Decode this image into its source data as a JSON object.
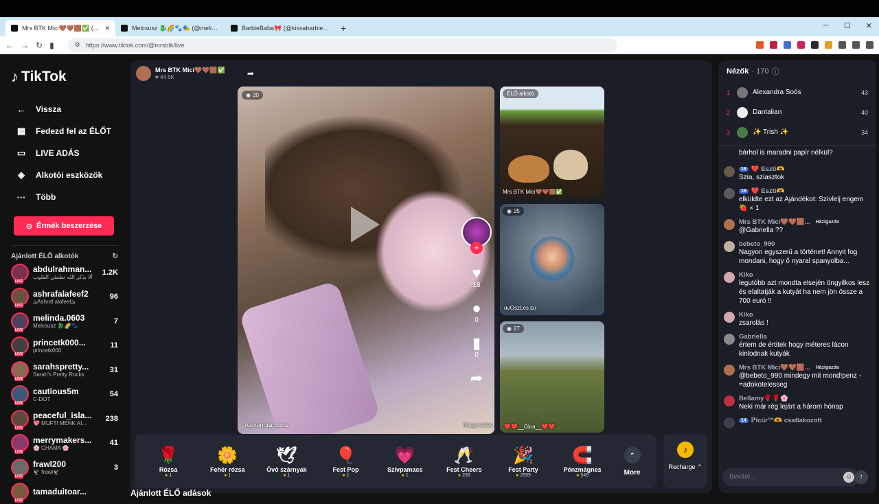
{
  "browser": {
    "tabs": [
      {
        "title": "Mrs BTK Mici🤎🤎🟫✅ (@m"
      },
      {
        "title": "Melcsusz 🐉🌈🐾🎭 (@melinda"
      },
      {
        "title": "BarbieBaba🎀 (@kissabarbie) ÉLŐ ad"
      }
    ],
    "new_tab": "+",
    "url": "https://www.tiktok.com/@mrsbtk/live"
  },
  "sidebar": {
    "logo": "TikTok",
    "nav": [
      {
        "label": "Vissza",
        "icon": "←"
      },
      {
        "label": "Fedezd fel az ÉLŐT",
        "icon": "▦"
      },
      {
        "label": "LIVE ADÁS",
        "icon": "▭"
      },
      {
        "label": "Alkotói eszközök",
        "icon": "◈"
      },
      {
        "label": "Több",
        "icon": "···"
      }
    ],
    "coins_button": "Érmék beszerzése",
    "recommended_title": "Ajánlott ÉLŐ alkotók",
    "creators": [
      {
        "name": "abdulrahman...",
        "sub": "ألا بذكر الله تطمئن القلوب",
        "count": "1.2K",
        "color": "#7a3050"
      },
      {
        "name": "ashrafalafeef2",
        "sub": "ئAshraf alafeefئ",
        "count": "96",
        "color": "#6a5040"
      },
      {
        "name": "melinda.0603",
        "sub": "Melcsusz 🐉🌈🐾",
        "count": "7",
        "color": "#504060"
      },
      {
        "name": "princetk000...",
        "sub": "princetk000",
        "count": "11",
        "color": "#404040"
      },
      {
        "name": "sarahspretty...",
        "sub": "Sarah's Pretty Rocks",
        "count": "31",
        "color": "#8a6a50"
      },
      {
        "name": "cautious5m",
        "sub": "C-DOT",
        "count": "54",
        "color": "#3a5a7a"
      },
      {
        "name": "peaceful_isla...",
        "sub": "💖 MUFTI MENK AI...",
        "count": "238",
        "color": "#5a4a3a"
      },
      {
        "name": "merrymakers...",
        "sub": "🌸 CHAMA 🌸",
        "count": "41",
        "color": "#8a3a6a"
      },
      {
        "name": "frawl200",
        "sub": "🦅 frawl🦅",
        "count": "3",
        "color": "#6a6a6a"
      },
      {
        "name": "tamaduitoar...",
        "sub": "",
        "count": "",
        "color": "#7a5a3a"
      }
    ]
  },
  "live": {
    "host_name": "Mrs BTK Mici🤎🤎🟫✅",
    "host_likes": "♥ 44.5K",
    "viewer_badge": "20",
    "video_user": "Alexandra Soós",
    "likes": "18",
    "comments": "0",
    "saves": "0",
    "share_label": "Megosztás",
    "side_streams": [
      {
        "badge": "ÉLŐ alkotó",
        "label": "Mrs BTK Mici🤎🤎🟫✅"
      },
      {
        "badge": "25",
        "label": "ʜᴜOszĿes ᴇᴜ"
      },
      {
        "badge": "27",
        "label": "❤️❤️__Gina__❤️❤️..."
      }
    ]
  },
  "gifts": [
    {
      "name": "Rózsa",
      "price": "1",
      "icon": "🌹"
    },
    {
      "name": "Fehér rózsa",
      "price": "1",
      "icon": "🌼"
    },
    {
      "name": "Óvó szárnyak",
      "price": "1",
      "icon": "🕊"
    },
    {
      "name": "Fest Pop",
      "price": "1",
      "icon": "🎈"
    },
    {
      "name": "Szívpamacs",
      "price": "1",
      "icon": "💗"
    },
    {
      "name": "Fest Cheers",
      "price": "299",
      "icon": "🥂"
    },
    {
      "name": "Fest Party",
      "price": "2999",
      "icon": "🎉"
    },
    {
      "name": "Pénzmágnes",
      "price": "549",
      "icon": "🧲"
    }
  ],
  "more_label": "More",
  "recharge_label": "Recharge ⌃",
  "bottom_title": "Ajánlott ÉLŐ adások",
  "chat": {
    "viewers_title": "Nézők",
    "viewers_count": "· 170",
    "top_viewers": [
      {
        "rank": "1",
        "name": "Alexandra Soós",
        "score": "43"
      },
      {
        "rank": "2",
        "name": "Dantalian",
        "score": "40"
      },
      {
        "rank": "3",
        "name": "✨ Trish ✨",
        "score": "34"
      }
    ],
    "messages": [
      {
        "user": "",
        "level": "",
        "host": "",
        "text": "bárhol is maradni papír nélkül?",
        "color": "transparent"
      },
      {
        "user": "❤️ Eszti🫶",
        "level": "16",
        "host": "",
        "text": "Szia, sziasztok",
        "color": "#6a5a4a"
      },
      {
        "user": "❤️ Eszti🫶",
        "level": "16",
        "host": "",
        "text": "elküldte ezt az Ajándékot: Szívlelj engem 🍓 × 1",
        "color": "#5a5a5a"
      },
      {
        "user": "Mrs BTK Mici🤎🤎🟫...",
        "level": "",
        "host": "Házigazda",
        "text": "@Gabriella ??",
        "color": "#b07050"
      },
      {
        "user": "bebeto_990",
        "level": "",
        "host": "",
        "text": "Nagyon egyszerű a történet! Annyit fog mondani, hogy ő nyaral spanyolba...",
        "color": "#c0b0a0"
      },
      {
        "user": "Kiko",
        "level": "",
        "host": "",
        "text": "legutóbb azt mondta elsején öngyilkos lesz és elaltatják a kutyát ha nem jön össze a 700 euró !!",
        "color": "#d0a8b0"
      },
      {
        "user": "Kiko",
        "level": "",
        "host": "",
        "text": "zsarolás !",
        "color": "#d0a8b0"
      },
      {
        "user": "Gabriella",
        "level": "",
        "host": "",
        "text": "értem de értitek hogy méteres lácon kinlodnak kutyák",
        "color": "#8a8a8a"
      },
      {
        "user": "Mrs BTK Mici🤎🤎🟫...",
        "level": "",
        "host": "Házigazda",
        "text": "@bebeto_990 mindegy mit mond!penz -=adokotelesseg",
        "color": "#b07050"
      },
      {
        "user": "Bellamy🌹🌹🌸",
        "level": "",
        "host": "",
        "text": "Neki már rég lejárt a három hónap",
        "color": "#c03040"
      },
      {
        "user": "ℙicúr™🫶 csatlakozott",
        "level": "14",
        "host": "",
        "text": "",
        "color": "#3a3f4c"
      }
    ],
    "input_placeholder": "Bevitel..."
  }
}
